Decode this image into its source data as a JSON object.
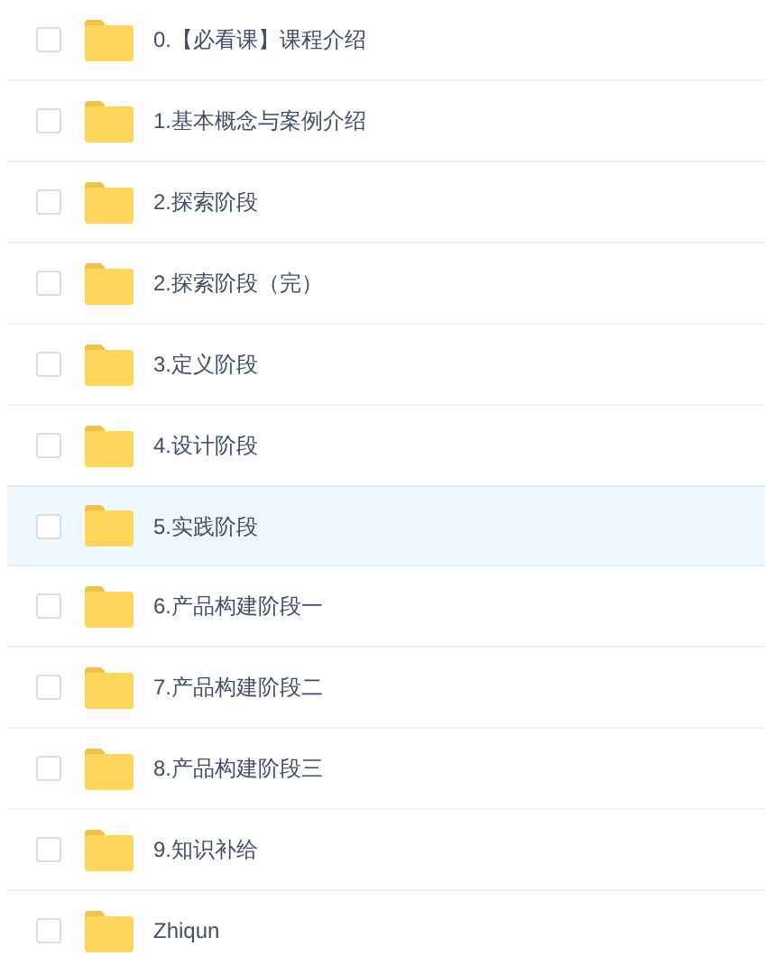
{
  "files": [
    {
      "name": "0.【必看课】课程介绍",
      "checked": false,
      "highlighted": false
    },
    {
      "name": "1.基本概念与案例介绍",
      "checked": false,
      "highlighted": false
    },
    {
      "name": "2.探索阶段",
      "checked": false,
      "highlighted": false
    },
    {
      "name": "2.探索阶段（完）",
      "checked": false,
      "highlighted": false
    },
    {
      "name": "3.定义阶段",
      "checked": false,
      "highlighted": false
    },
    {
      "name": "4.设计阶段",
      "checked": false,
      "highlighted": false
    },
    {
      "name": "5.实践阶段",
      "checked": false,
      "highlighted": true
    },
    {
      "name": "6.产品构建阶段一",
      "checked": false,
      "highlighted": false
    },
    {
      "name": "7.产品构建阶段二",
      "checked": false,
      "highlighted": false
    },
    {
      "name": "8.产品构建阶段三",
      "checked": false,
      "highlighted": false
    },
    {
      "name": "9.知识补给",
      "checked": false,
      "highlighted": false
    },
    {
      "name": "Zhiqun",
      "checked": false,
      "highlighted": false
    }
  ]
}
